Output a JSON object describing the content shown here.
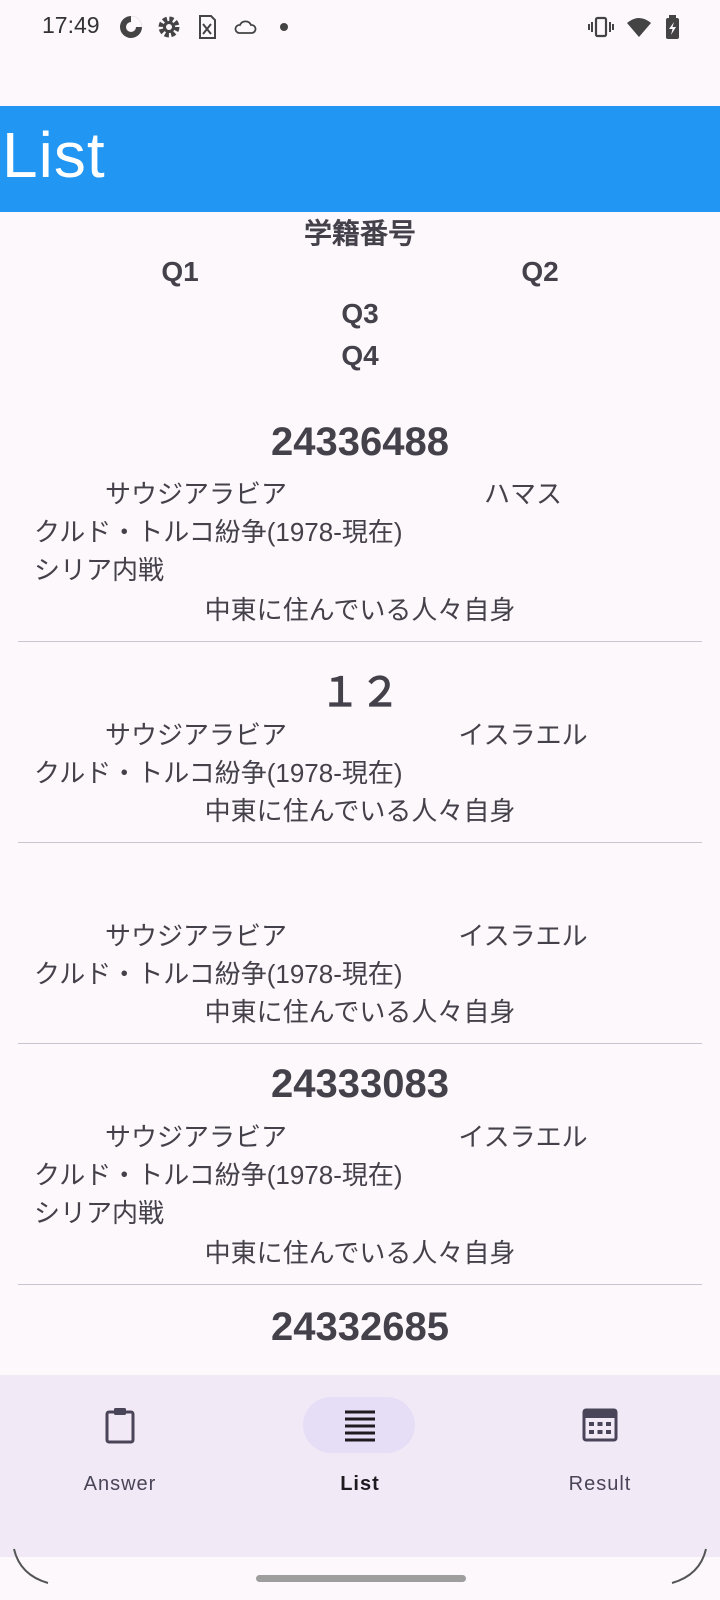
{
  "status_bar": {
    "time": "17:49",
    "icons": [
      "data-saver-icon",
      "settings-icon",
      "sim-off-icon",
      "cloud-icon",
      "dot-icon",
      "vibrate-icon",
      "wifi-icon",
      "battery-charging-icon"
    ]
  },
  "app_bar": {
    "title": "List"
  },
  "header": {
    "student_id": "学籍番号",
    "q1": "Q1",
    "q2": "Q2",
    "q3": "Q3",
    "q4": "Q4"
  },
  "entries": [
    {
      "id": "24336488",
      "q1": "サウジアラビア",
      "q2": "ハマス",
      "q3_lines": [
        "クルド・トルコ紛争(1978-現在)",
        "シリア内戦"
      ],
      "q4": "中東に住んでいる人々自身"
    },
    {
      "id": "１２",
      "q1": "サウジアラビア",
      "q2": "イスラエル",
      "q3_lines": [
        "クルド・トルコ紛争(1978-現在)"
      ],
      "q4": "中東に住んでいる人々自身"
    },
    {
      "id": "",
      "q1": "サウジアラビア",
      "q2": "イスラエル",
      "q3_lines": [
        "クルド・トルコ紛争(1978-現在)"
      ],
      "q4": "中東に住んでいる人々自身"
    },
    {
      "id": "24333083",
      "q1": "サウジアラビア",
      "q2": "イスラエル",
      "q3_lines": [
        "クルド・トルコ紛争(1978-現在)",
        "シリア内戦"
      ],
      "q4": "中東に住んでいる人々自身"
    },
    {
      "id": "24332685"
    }
  ],
  "bottom_nav": {
    "items": [
      {
        "label": "Answer",
        "icon": "clipboard-icon",
        "active": false
      },
      {
        "label": "List",
        "icon": "list-icon",
        "active": true
      },
      {
        "label": "Result",
        "icon": "calculator-icon",
        "active": false
      }
    ]
  },
  "colors": {
    "app_bar": "#2196f3",
    "background": "#fdf8fc",
    "nav_background": "#f1eaf6",
    "nav_active_pill": "#e6def6",
    "text": "#44414a"
  }
}
